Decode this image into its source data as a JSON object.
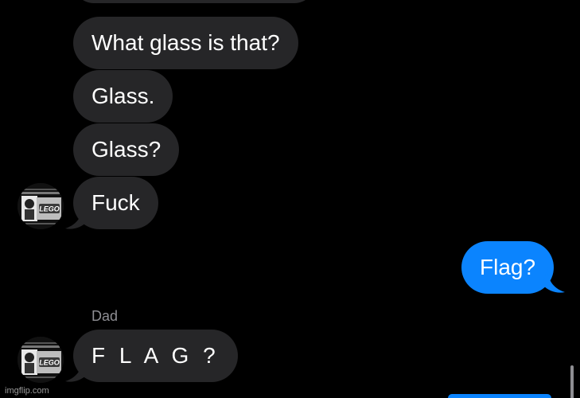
{
  "conversation": {
    "messages": [
      {
        "direction": "incoming",
        "text": "What glass is that?"
      },
      {
        "direction": "incoming",
        "text": "Glass."
      },
      {
        "direction": "incoming",
        "text": "Glass?"
      },
      {
        "direction": "incoming",
        "text": "Fuck"
      },
      {
        "direction": "outgoing",
        "text": "Flag?"
      },
      {
        "direction": "incoming",
        "sender": "Dad",
        "text": "F L A G ?"
      }
    ]
  },
  "avatar": {
    "logo_text": "LEGO"
  },
  "watermark": {
    "text": "imgflip.com"
  },
  "colors": {
    "background": "#000000",
    "incoming_bubble": "#262628",
    "outgoing_bubble": "#0b84fe",
    "sender_label": "#8e8e93"
  }
}
